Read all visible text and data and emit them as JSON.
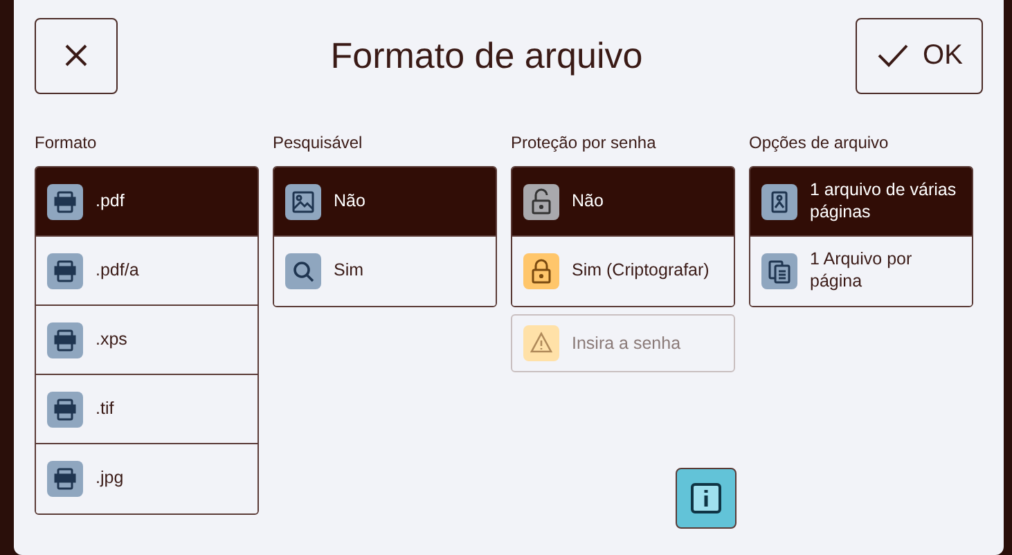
{
  "dialog": {
    "title": "Formato de arquivo",
    "ok_label": "OK"
  },
  "columns": [
    {
      "heading": "Formato",
      "items": [
        {
          "label": ".pdf",
          "selected": true
        },
        {
          "label": ".pdf/a",
          "selected": false
        },
        {
          "label": ".xps",
          "selected": false
        },
        {
          "label": ".tif",
          "selected": false
        },
        {
          "label": ".jpg",
          "selected": false
        }
      ]
    },
    {
      "heading": "Pesquisável",
      "items": [
        {
          "label": "Não",
          "selected": true
        },
        {
          "label": "Sim",
          "selected": false
        }
      ]
    },
    {
      "heading": "Proteção por senha",
      "items": [
        {
          "label": "Não",
          "selected": true
        },
        {
          "label": "Sim (Criptografar)",
          "selected": false
        }
      ],
      "password_button": {
        "label": "Insira a senha",
        "disabled": true
      }
    },
    {
      "heading": "Opções de arquivo",
      "items": [
        {
          "label": "1 arquivo de várias páginas",
          "selected": true
        },
        {
          "label": "1 Arquivo por página",
          "selected": false
        }
      ]
    }
  ]
}
